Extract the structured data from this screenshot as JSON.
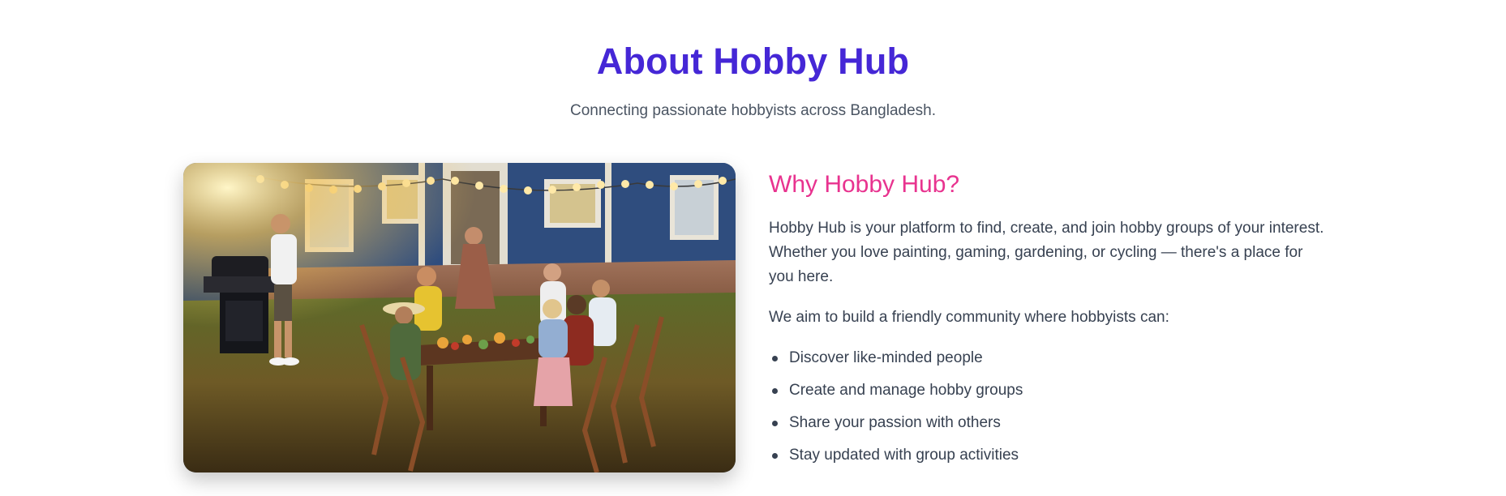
{
  "header": {
    "title": "About Hobby Hub",
    "subtitle": "Connecting passionate hobbyists across Bangladesh."
  },
  "image": {
    "icon": "outdoor-dinner-photo"
  },
  "about": {
    "title": "Why Hobby Hub?",
    "paragraph1": "Hobby Hub is your platform to find, create, and join hobby groups of your interest. Whether you love painting, gaming, gardening, or cycling — there's a place for you here.",
    "paragraph2": "We aim to build a friendly community where hobbyists can:",
    "points": [
      "Discover like-minded people",
      "Create and manage hobby groups",
      "Share your passion with others",
      "Stay updated with group activities"
    ]
  },
  "colors": {
    "title": "#4527d6",
    "accent": "#e8338f",
    "text": "#374151"
  }
}
